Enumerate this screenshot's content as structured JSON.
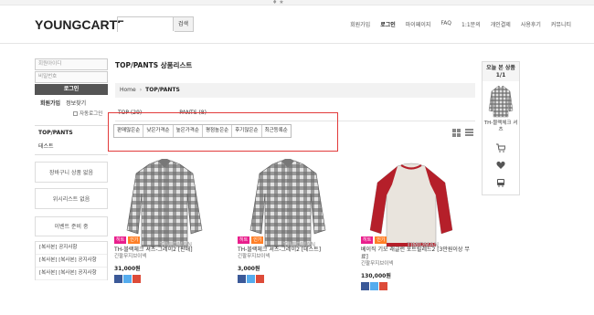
{
  "header": {
    "logo": "YOUNGCART5",
    "search_placeholder": "",
    "search_button": "검색",
    "gnb": [
      "회원가입",
      "로그인",
      "마이페이지",
      "FAQ",
      "1:1문의",
      "개인결제",
      "사용후기",
      "커뮤니티"
    ]
  },
  "login": {
    "id_placeholder": "회원아이디",
    "pw_placeholder": "비밀번호",
    "login_button": "로그인",
    "join_link": "회원가입",
    "find_link": "정보찾기",
    "auto_login": "자동로그인"
  },
  "category": {
    "current": "TOP/PANTS",
    "sub": "테스트"
  },
  "side_boxes": {
    "cart_empty": "장바구니 상품 없음",
    "wish_empty": "위시리스트 없음",
    "event_empty": "이벤트 준비 중"
  },
  "notice": [
    "[복사본] 공지사항",
    "[복사본] [복사본] 공지사항",
    "[복사본] [복사본] 공지사항"
  ],
  "main": {
    "page_title": "TOP/PANTS 상품리스트",
    "breadcrumb_home": "Home",
    "breadcrumb_current": "TOP/PANTS",
    "tabs": [
      "TOP (29)",
      "PANTS (8)"
    ],
    "sort_options": [
      "판매많은순",
      "낮은가격순",
      "높은가격순",
      "평점높은순",
      "후기많은순",
      "최근등록순"
    ]
  },
  "products": [
    {
      "name": "TH-블랙체크 셔츠-그레이2 [판매]",
      "maker": "긴팔무지브이넥",
      "price": "31,000원",
      "watermark": "TIMIDMAN",
      "badges": [
        "히트",
        "인기"
      ]
    },
    {
      "name": "TH-블랙체크 셔츠-그레이2 [테스트]",
      "maker": "긴팔무지브이넥",
      "price": "3,000원",
      "watermark": "TIMIDMAN",
      "badges": [
        "히트",
        "인기"
      ]
    },
    {
      "name": "베이직 기모 래글런 포트릴레드2 [3만원이상 무료]",
      "maker": "긴팔무지브이넥",
      "price": "130,000원",
      "watermark": "TIMIDMAN",
      "badges": [
        "히트",
        "인기"
      ]
    }
  ],
  "today": {
    "title": "오늘 본 상품",
    "count": "1/1",
    "item_name": "TH-블랙체크 셔츠"
  },
  "colors": {
    "hit": "#e91e8c",
    "best": "#ff7f27",
    "highlight": "#e23b3b"
  }
}
